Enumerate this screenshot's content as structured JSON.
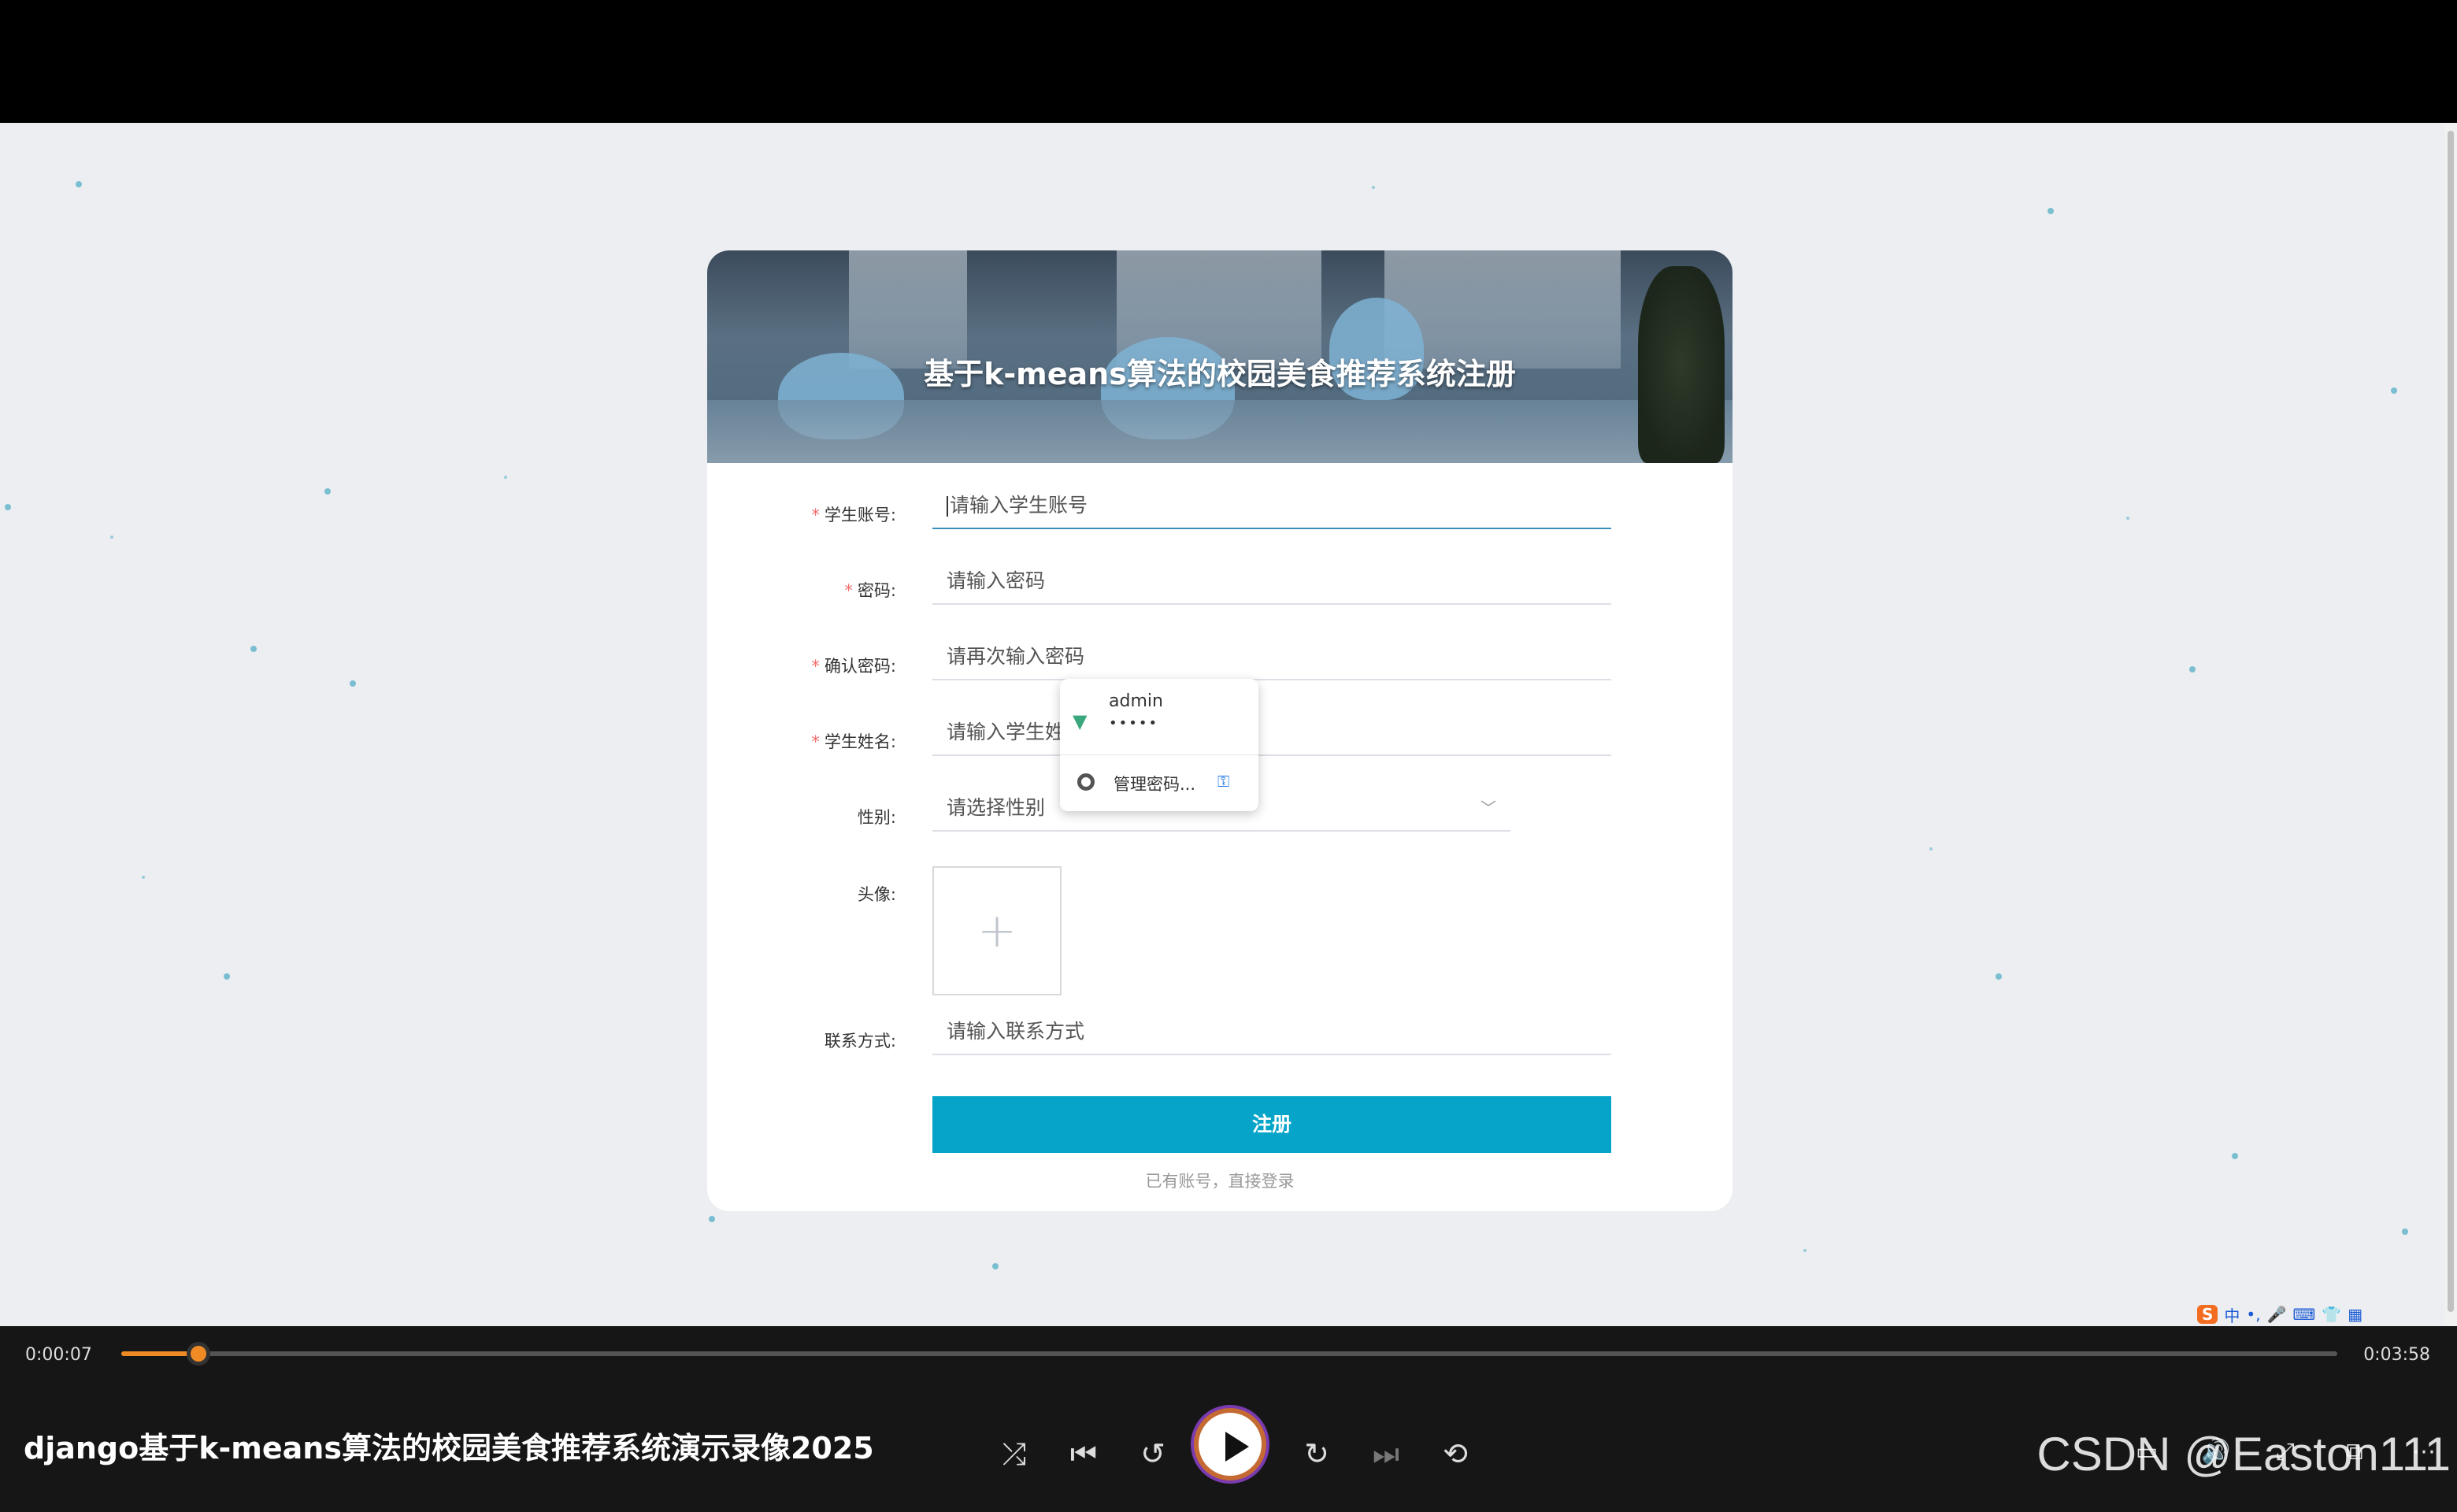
{
  "form": {
    "banner_title": "基于k-means算法的校园美食推荐系统注册",
    "fields": [
      {
        "label": "学生账号:",
        "required": true,
        "placeholder": "请输入学生账号"
      },
      {
        "label": "密码:",
        "required": true,
        "placeholder": "请输入密码"
      },
      {
        "label": "确认密码:",
        "required": true,
        "placeholder": "请再次输入密码"
      },
      {
        "label": "学生姓名:",
        "required": true,
        "placeholder": "请输入学生姓名"
      },
      {
        "label": "性别:",
        "required": false,
        "placeholder": "请选择性别"
      },
      {
        "label": "头像:",
        "required": false
      },
      {
        "label": "联系方式:",
        "required": false,
        "placeholder": "请输入联系方式"
      }
    ],
    "required_mark": "*",
    "select_arrow": "﹀",
    "upload_plus": "+",
    "register_button": "注册",
    "login_link": "已有账号，直接登录"
  },
  "autofill": {
    "username": "admin",
    "password_mask": "•••••",
    "manage_label": "管理密码...",
    "vue_icon": "vue-icon",
    "chrome_icon": "chrome-icon",
    "key_icon": "key-icon"
  },
  "ime": {
    "logo": "S",
    "mode": "中"
  },
  "player": {
    "current_time": "0:00:07",
    "total_time": "0:03:58",
    "progress": 0.035,
    "video_title": "django基于k-means算法的校园美食推荐系统演示录像2025",
    "watermark": "CSDN @Easton111"
  },
  "colors": {
    "accent": "#05a4c8",
    "progress": "#f08a24",
    "required": "#f56c6c"
  }
}
